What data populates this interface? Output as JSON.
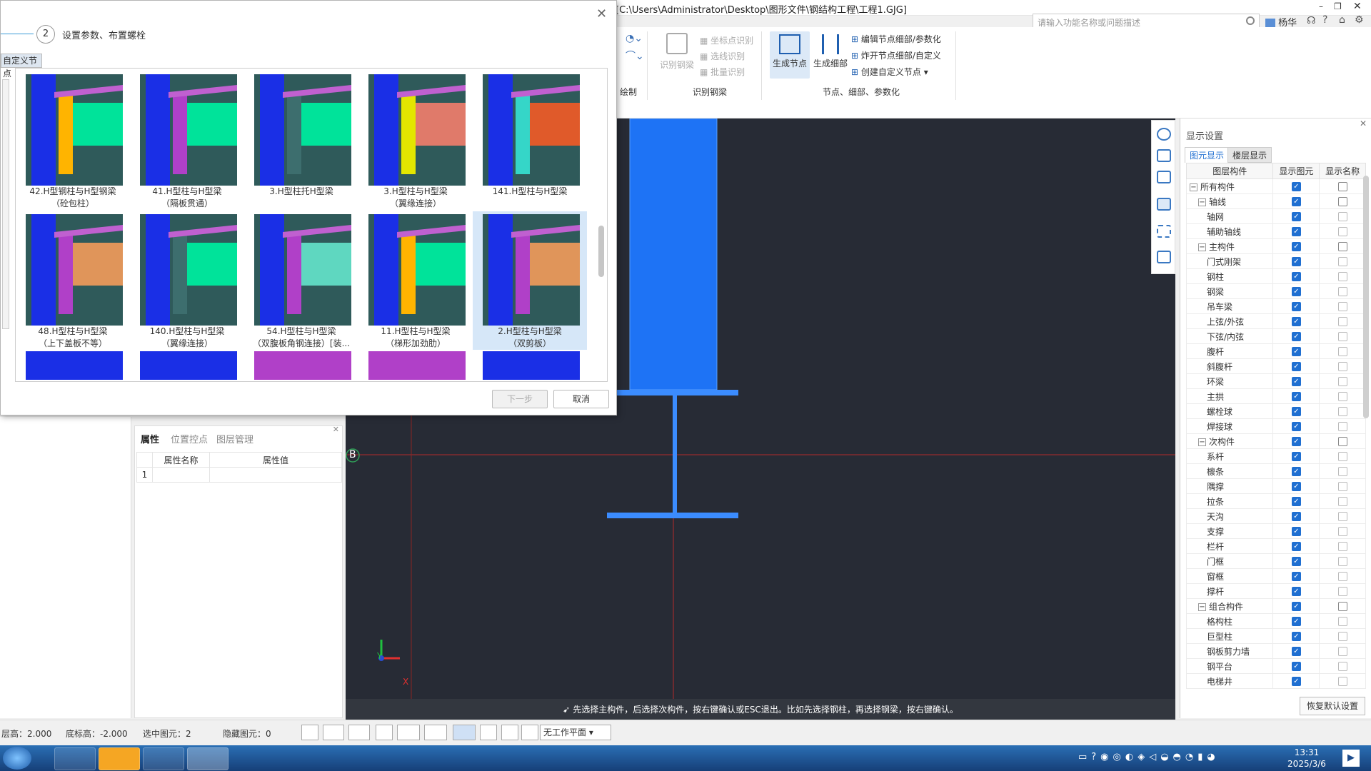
{
  "window": {
    "title_path": "[C:\\Users\\Administrator\\Desktop\\图形文件\\钢结构工程\\工程1.GJG]"
  },
  "search": {
    "placeholder": "请输入功能名称或问题描述"
  },
  "user": {
    "name": "杨华"
  },
  "ribbon": {
    "draw_group": "绘制",
    "recognize": {
      "big": "识别钢梁",
      "items": [
        "坐标点识别",
        "选线识别",
        "批量识别"
      ],
      "group": "识别钢梁"
    },
    "nodes": {
      "gen_node": "生成节点",
      "gen_detail": "生成细部",
      "items": [
        "编辑节点细部/参数化",
        "炸开节点细部/自定义",
        "创建自定义节点"
      ],
      "group": "节点、细部、参数化"
    }
  },
  "dialog": {
    "step_number": "2",
    "step_label": "设置参数、布置螺栓",
    "tab_label": "自定义节点",
    "cards": [
      {
        "line1": "42.H型钢柱与H型钢梁",
        "line2": "（砼包柱）"
      },
      {
        "line1": "41.H型柱与H型梁",
        "line2": "（隔板贯通）"
      },
      {
        "line1": "3.H型柱托H型梁",
        "line2": ""
      },
      {
        "line1": "3.H型柱与H型梁",
        "line2": "（翼缘连接）"
      },
      {
        "line1": "141.H型柱与H型梁",
        "line2": ""
      },
      {
        "line1": "48.H型柱与H型梁",
        "line2": "（上下盖板不等）"
      },
      {
        "line1": "140.H型柱与H型梁",
        "line2": "（翼缘连接）"
      },
      {
        "line1": "54.H型柱与H型梁",
        "line2": "（双腹板角钢连接）[装..."
      },
      {
        "line1": "11.H型柱与H型梁",
        "line2": "（梯形加劲肋）"
      },
      {
        "line1": "2.H型柱与H型梁",
        "line2": "（双剪板）"
      }
    ],
    "next_label": "下一步",
    "cancel_label": "取消"
  },
  "props": {
    "tabs": [
      "属性",
      "位置控点",
      "图层管理"
    ],
    "col_name": "属性名称",
    "col_value": "属性值",
    "row1": "1"
  },
  "viewport": {
    "axis_label": "B",
    "x_label": "X",
    "y_label": "Y",
    "message": "先选择主构件，后选择次构件，按右键确认或ESC退出。比如先选择钢柱，再选择钢梁，按右键确认。"
  },
  "display": {
    "title": "显示设置",
    "tab1": "图元显示",
    "tab2": "楼层显示",
    "col1": "图层构件",
    "col2": "显示图元",
    "col3": "显示名称",
    "rows": [
      {
        "label": "所有构件",
        "level": 0,
        "toggle": "−"
      },
      {
        "label": "轴线",
        "level": 1,
        "toggle": "−"
      },
      {
        "label": "轴网",
        "level": 2
      },
      {
        "label": "辅助轴线",
        "level": 2
      },
      {
        "label": "主构件",
        "level": 1,
        "toggle": "−"
      },
      {
        "label": "门式刚架",
        "level": 2
      },
      {
        "label": "钢柱",
        "level": 2
      },
      {
        "label": "钢梁",
        "level": 2
      },
      {
        "label": "吊车梁",
        "level": 2
      },
      {
        "label": "上弦/外弦",
        "level": 2
      },
      {
        "label": "下弦/内弦",
        "level": 2
      },
      {
        "label": "腹杆",
        "level": 2
      },
      {
        "label": "斜腹杆",
        "level": 2
      },
      {
        "label": "环梁",
        "level": 2
      },
      {
        "label": "主拱",
        "level": 2
      },
      {
        "label": "螺栓球",
        "level": 2
      },
      {
        "label": "焊接球",
        "level": 2
      },
      {
        "label": "次构件",
        "level": 1,
        "toggle": "−"
      },
      {
        "label": "系杆",
        "level": 2
      },
      {
        "label": "檩条",
        "level": 2
      },
      {
        "label": "隅撑",
        "level": 2
      },
      {
        "label": "拉条",
        "level": 2
      },
      {
        "label": "天沟",
        "level": 2
      },
      {
        "label": "支撑",
        "level": 2
      },
      {
        "label": "栏杆",
        "level": 2
      },
      {
        "label": "门框",
        "level": 2
      },
      {
        "label": "窗框",
        "level": 2
      },
      {
        "label": "撑杆",
        "level": 2
      },
      {
        "label": "组合构件",
        "level": 1,
        "toggle": "−"
      },
      {
        "label": "格构柱",
        "level": 2
      },
      {
        "label": "巨型柱",
        "level": 2
      },
      {
        "label": "钢板剪力墙",
        "level": 2
      },
      {
        "label": "钢平台",
        "level": 2
      },
      {
        "label": "电梯井",
        "level": 2
      }
    ],
    "restore_label": "恢复默认设置"
  },
  "status": {
    "floor_height": "层高：2.000",
    "base_elev": "底标高：-2.000",
    "selected": "选中图元：2",
    "hidden": "隐藏图元：0",
    "plane": "无工作平面"
  },
  "clock": {
    "time": "13:31",
    "date": "2025/3/6"
  },
  "colors": {
    "column_blue": "#1c5ff0",
    "beam_green": "#00e39a",
    "viewport_bg": "#272b35",
    "accent": "#1f6fd1"
  }
}
